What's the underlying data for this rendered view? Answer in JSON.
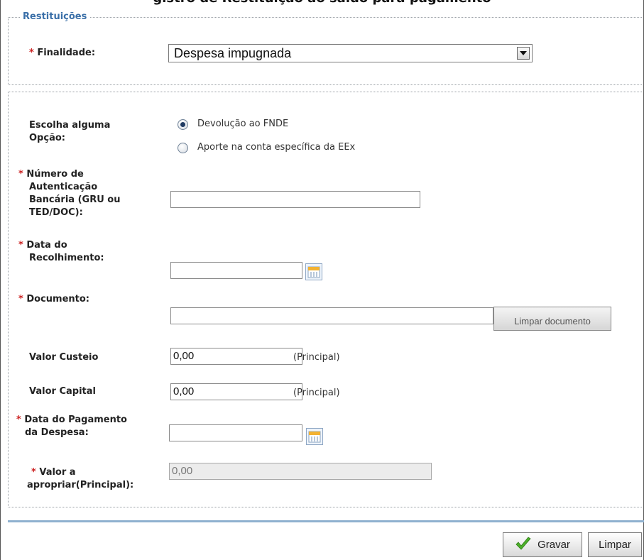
{
  "page": {
    "top_title_fragment": "gistro de Restituição ao saldo para pagamento"
  },
  "section": {
    "legend": "Restituições"
  },
  "form": {
    "finalidade": {
      "required_mark": "*",
      "label": "Finalidade:",
      "selected": "Despesa impugnada"
    },
    "opcao": {
      "label_line1": "Escolha alguma",
      "label_line2": "Opção:",
      "options": [
        {
          "label": "Devolução ao FNDE",
          "checked": true
        },
        {
          "label": "Aporte na conta específica da EEx",
          "checked": false
        }
      ]
    },
    "numero_autenticacao": {
      "required_mark": "*",
      "label_lines": [
        "Número de",
        "Autenticação",
        "Bancária (GRU ou",
        "TED/DOC):"
      ],
      "value": ""
    },
    "data_recolhimento": {
      "required_mark": "*",
      "label_lines": [
        "Data do",
        "Recolhimento:"
      ],
      "value": ""
    },
    "documento": {
      "required_mark": "*",
      "label": "Documento:",
      "value": "",
      "clear_button": "Limpar documento"
    },
    "valor_custeio": {
      "label": "Valor Custeio",
      "value": "0,00",
      "suffix": "(Principal)"
    },
    "valor_capital": {
      "label": "Valor Capital",
      "value": "0,00",
      "suffix": "(Principal)"
    },
    "data_pagamento": {
      "required_mark": "*",
      "label_lines": [
        "Data do Pagamento",
        "da Despesa:"
      ],
      "value": ""
    },
    "valor_apropriar": {
      "required_mark": "*",
      "label_lines": [
        "Valor a",
        "apropriar(Principal):"
      ],
      "value": "0,00"
    }
  },
  "actions": {
    "save_label": "Gravar",
    "clear_label": "Limpar"
  },
  "colors": {
    "legend": "#3a6fa8",
    "required": "#cc2222",
    "accent_line": "#8fb1cf",
    "check": "#4caf2a"
  },
  "icons": {
    "calendar": "calendar-icon",
    "save": "check-icon",
    "dropdown": "chevron-down-icon"
  }
}
